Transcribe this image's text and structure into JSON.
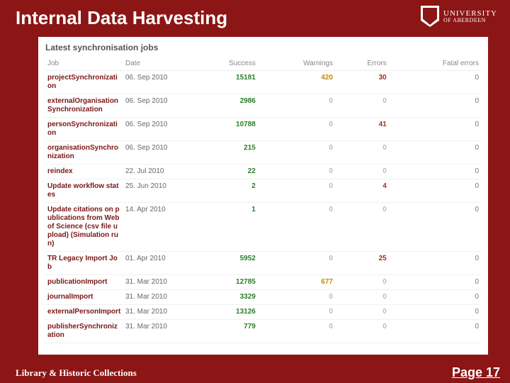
{
  "header": {
    "title": "Internal Data Harvesting",
    "brand_line1": "UNIVERSITY",
    "brand_line2": "OF ABERDEEN"
  },
  "panel": {
    "title": "Latest synchronisation jobs",
    "columns": {
      "job": "Job",
      "date": "Date",
      "success": "Success",
      "warnings": "Warnings",
      "errors": "Errors",
      "fatal": "Fatal errors"
    },
    "rows": [
      {
        "job": "projectSynchronization",
        "date": "06. Sep 2010",
        "success": "15181",
        "warnings": "420",
        "warn_hot": true,
        "errors": "30",
        "err_hot": true,
        "fatal": "0"
      },
      {
        "job": "externalOrganisationSynchronization",
        "date": "06. Sep 2010",
        "success": "2986",
        "warnings": "0",
        "warn_hot": false,
        "errors": "0",
        "err_hot": false,
        "fatal": "0"
      },
      {
        "job": "personSynchronization",
        "date": "06. Sep 2010",
        "success": "10788",
        "warnings": "0",
        "warn_hot": false,
        "errors": "41",
        "err_hot": true,
        "fatal": "0"
      },
      {
        "job": "organisationSynchronization",
        "date": "06. Sep 2010",
        "success": "215",
        "warnings": "0",
        "warn_hot": false,
        "errors": "0",
        "err_hot": false,
        "fatal": "0"
      },
      {
        "job": "reindex",
        "date": "22. Jul 2010",
        "success": "22",
        "warnings": "0",
        "warn_hot": false,
        "errors": "0",
        "err_hot": false,
        "fatal": "0"
      },
      {
        "job": "Update workflow states",
        "date": "25. Jun 2010",
        "success": "2",
        "warnings": "0",
        "warn_hot": false,
        "errors": "4",
        "err_hot": true,
        "fatal": "0"
      },
      {
        "job": "Update citations on publications from Web of Science (csv file upload) (Simulation run)",
        "date": "14. Apr 2010",
        "success": "1",
        "warnings": "0",
        "warn_hot": false,
        "errors": "0",
        "err_hot": false,
        "fatal": "0"
      },
      {
        "job": "TR Legacy Import Job",
        "date": "01. Apr 2010",
        "success": "5952",
        "warnings": "0",
        "warn_hot": false,
        "errors": "25",
        "err_hot": true,
        "fatal": "0"
      },
      {
        "job": "publicationImport",
        "date": "31. Mar 2010",
        "success": "12785",
        "warnings": "677",
        "warn_hot": true,
        "errors": "0",
        "err_hot": false,
        "fatal": "0"
      },
      {
        "job": "journalImport",
        "date": "31. Mar 2010",
        "success": "3329",
        "warnings": "0",
        "warn_hot": false,
        "errors": "0",
        "err_hot": false,
        "fatal": "0"
      },
      {
        "job": "externalPersonImport",
        "date": "31. Mar 2010",
        "success": "13126",
        "warnings": "0",
        "warn_hot": false,
        "errors": "0",
        "err_hot": false,
        "fatal": "0"
      },
      {
        "job": "publisherSynchronization",
        "date": "31. Mar 2010",
        "success": "779",
        "warnings": "0",
        "warn_hot": false,
        "errors": "0",
        "err_hot": false,
        "fatal": "0"
      }
    ]
  },
  "footer": {
    "left": "Library & Historic Collections",
    "right": "Page 17"
  }
}
